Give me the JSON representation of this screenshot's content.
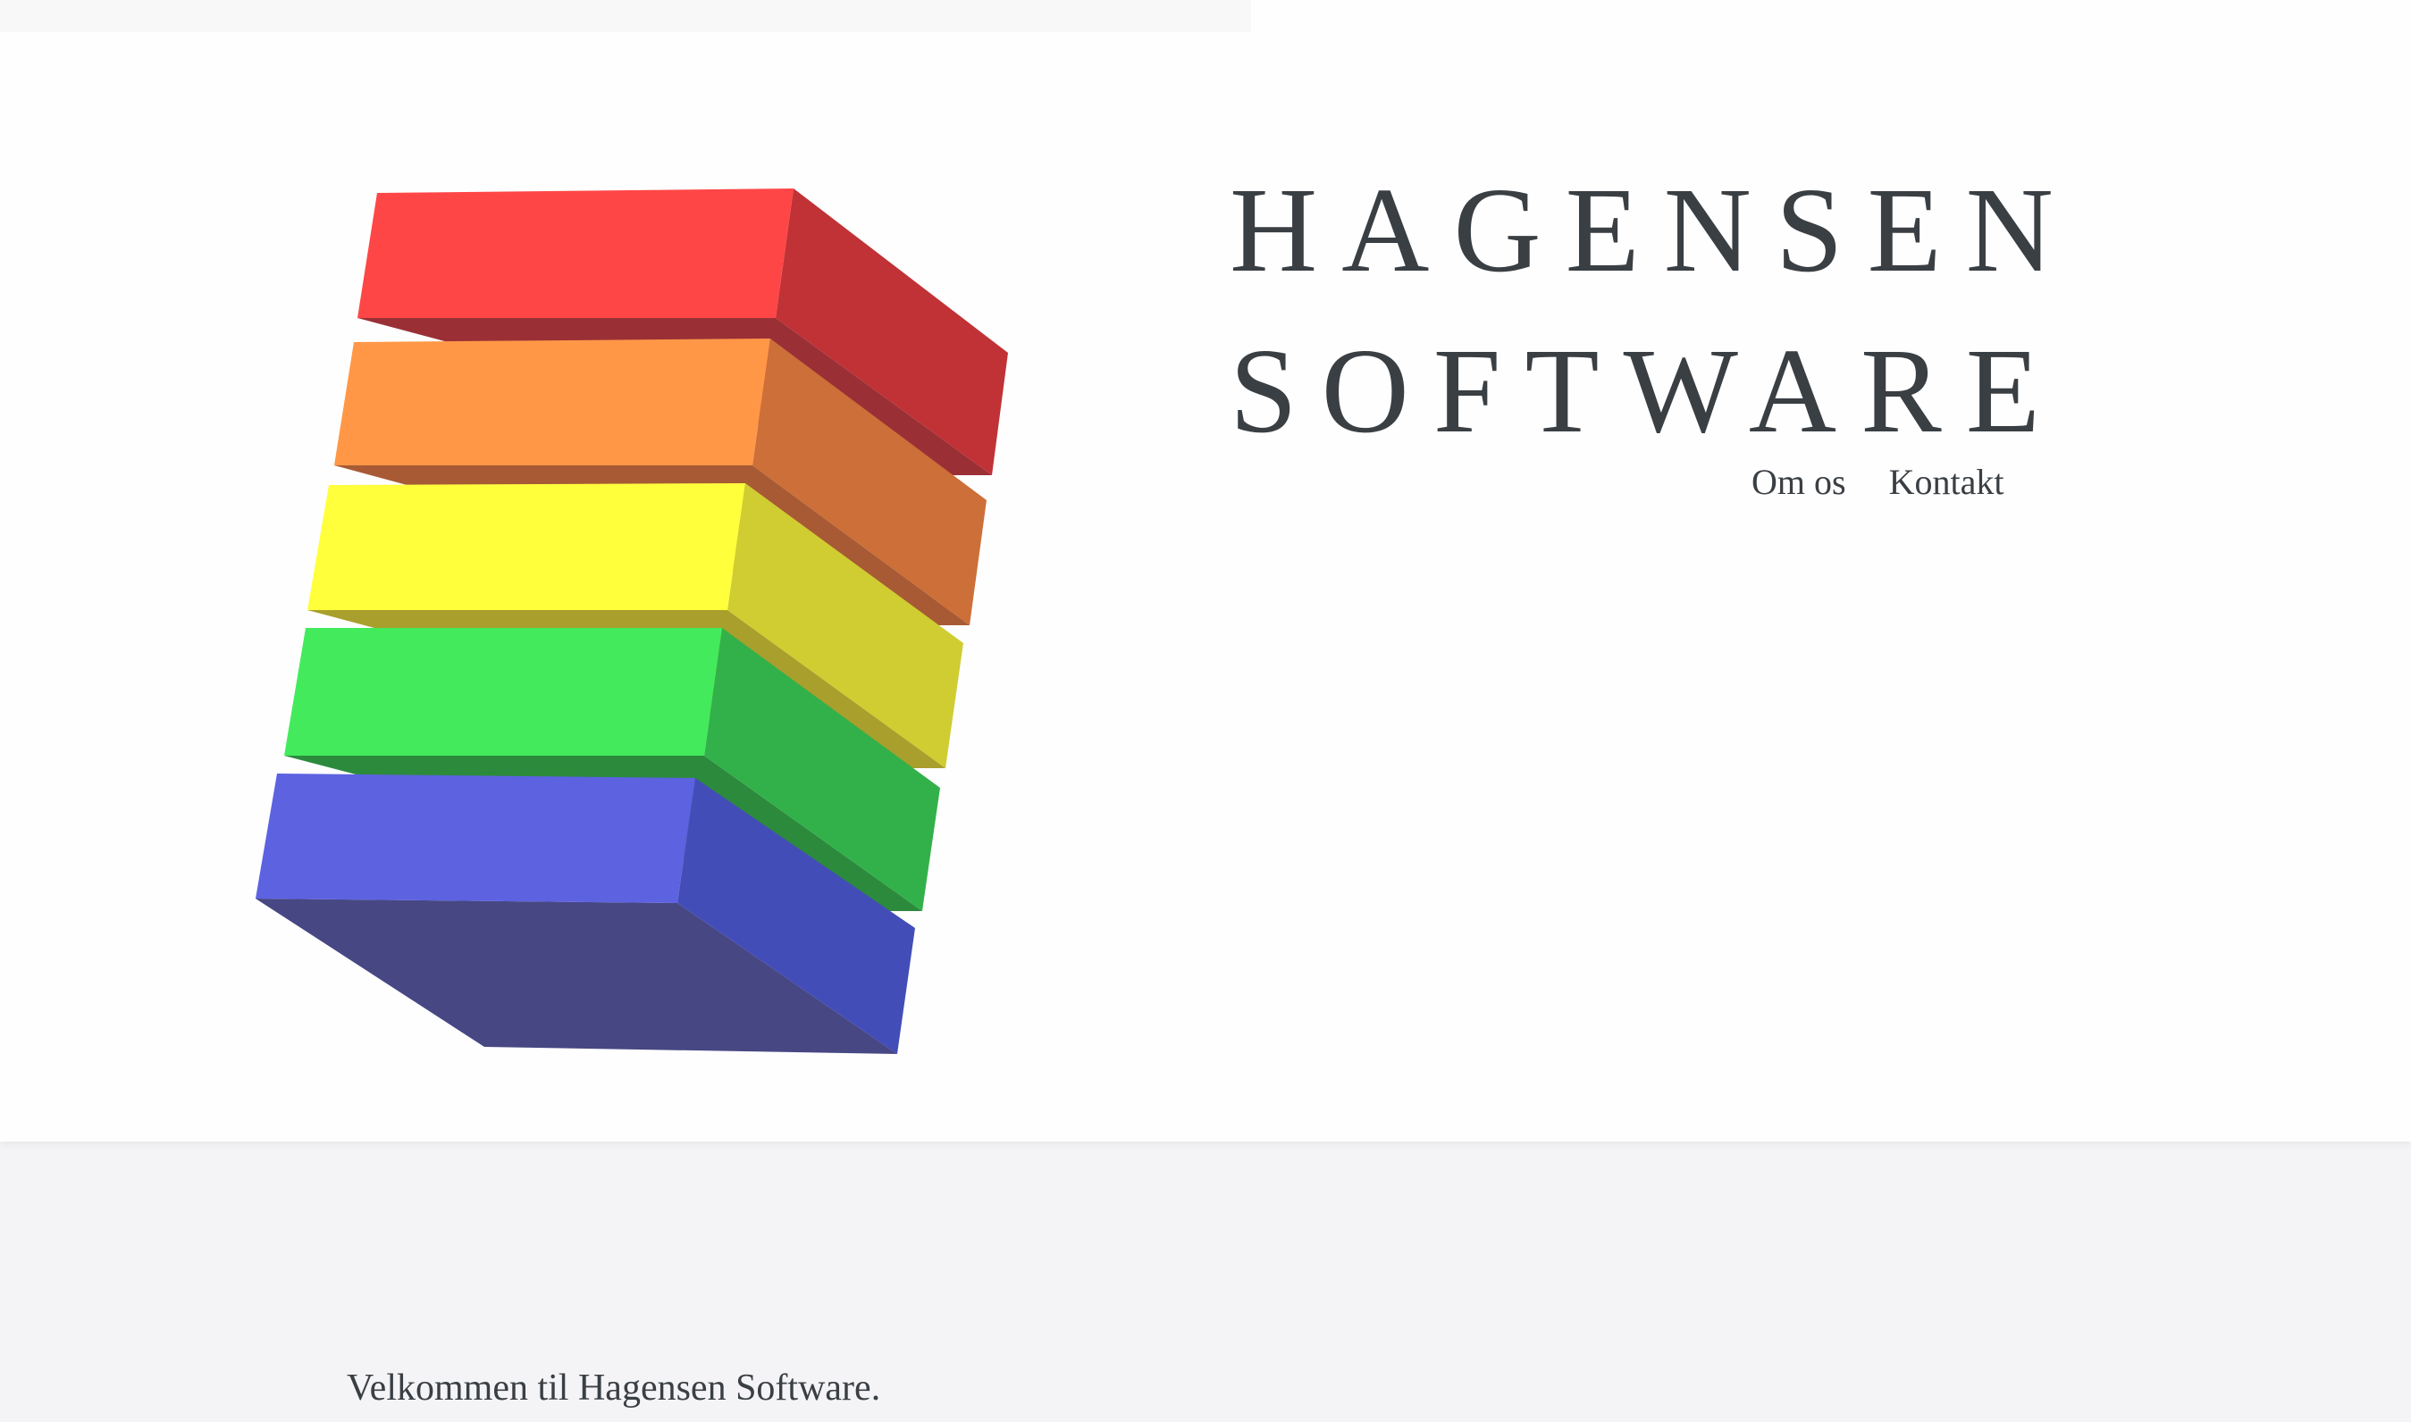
{
  "header": {
    "brand_line_1": "HAGENSEN",
    "brand_line_2": "SOFTWARE",
    "nav": [
      {
        "label": "Om os"
      },
      {
        "label": "Kontakt"
      }
    ]
  },
  "logo": {
    "icon": "rainbow-stacked-blocks-icon",
    "layers": [
      {
        "name": "red",
        "front": "#ff4646",
        "side": "#c03236",
        "bottom": "#9a3036"
      },
      {
        "name": "orange",
        "front": "#ff9747",
        "side": "#cc6f38",
        "bottom": "#a85a34"
      },
      {
        "name": "yellow",
        "front": "#ffff3c",
        "side": "#cfcd31",
        "bottom": "#a89f2c"
      },
      {
        "name": "green",
        "front": "#43eb5c",
        "side": "#32b14a",
        "bottom": "#2c8a3d"
      },
      {
        "name": "blue",
        "front": "#5c62e0",
        "side": "#434db7",
        "bottom": "#474784"
      }
    ]
  },
  "main": {
    "welcome_text": "Velkommen til Hagensen Software."
  },
  "colors": {
    "header_bg": "#fefefe",
    "page_bg": "#f4f4f6",
    "text": "#3a3f44"
  }
}
